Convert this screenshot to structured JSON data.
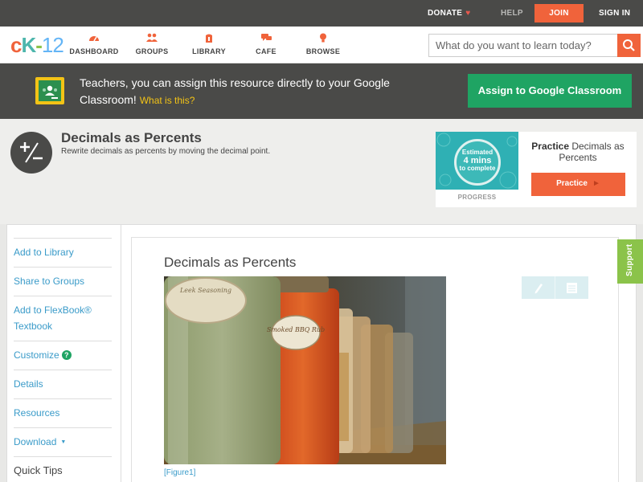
{
  "topbar": {
    "donate": "DONATE",
    "help": "HELP",
    "join": "JOIN",
    "sign_in": "SIGN IN"
  },
  "nav": {
    "logo_c": "c",
    "logo_k": "K",
    "logo_dash": "-",
    "logo_n": "12",
    "items": [
      {
        "label": "DASHBOARD",
        "icon": "dashboard-icon"
      },
      {
        "label": "GROUPS",
        "icon": "groups-icon"
      },
      {
        "label": "LIBRARY",
        "icon": "library-icon"
      },
      {
        "label": "CAFE",
        "icon": "cafe-icon"
      },
      {
        "label": "BROWSE",
        "icon": "browse-icon"
      }
    ],
    "search_placeholder": "What do you want to learn today?"
  },
  "google_banner": {
    "text": "Teachers, you can assign this resource directly to your Google Classroom!",
    "what_link": "What is this?",
    "button": "Assign to Google Classroom"
  },
  "concept": {
    "title": "Decimals as Percents",
    "subtitle": "Rewrite decimals as percents by moving the decimal point."
  },
  "practice_card": {
    "estimated": "Estimated",
    "minutes": "4 mins",
    "to_complete": "to complete",
    "progress_label": "PROGRESS",
    "title_bold": "Practice",
    "title_rest": " Decimals as Percents",
    "button": "Practice"
  },
  "sidebar": {
    "add_library": "Add to Library",
    "share_groups": "Share to Groups",
    "add_flexbook": "Add to FlexBook® Textbook",
    "customize": "Customize",
    "details": "Details",
    "resources": "Resources",
    "download": "Download",
    "quick_tips": "Quick Tips"
  },
  "content": {
    "title": "Decimals as Percents",
    "label_left": "Leek Seasoning",
    "label_right": "Smoked BBQ Rub",
    "figure_link": "[Figure1]"
  },
  "support": "Support",
  "colors": {
    "brand_orange": "#f0633b",
    "google_green": "#1fa463",
    "link_blue": "#3a9bc9",
    "support_green": "#8bc34a"
  }
}
